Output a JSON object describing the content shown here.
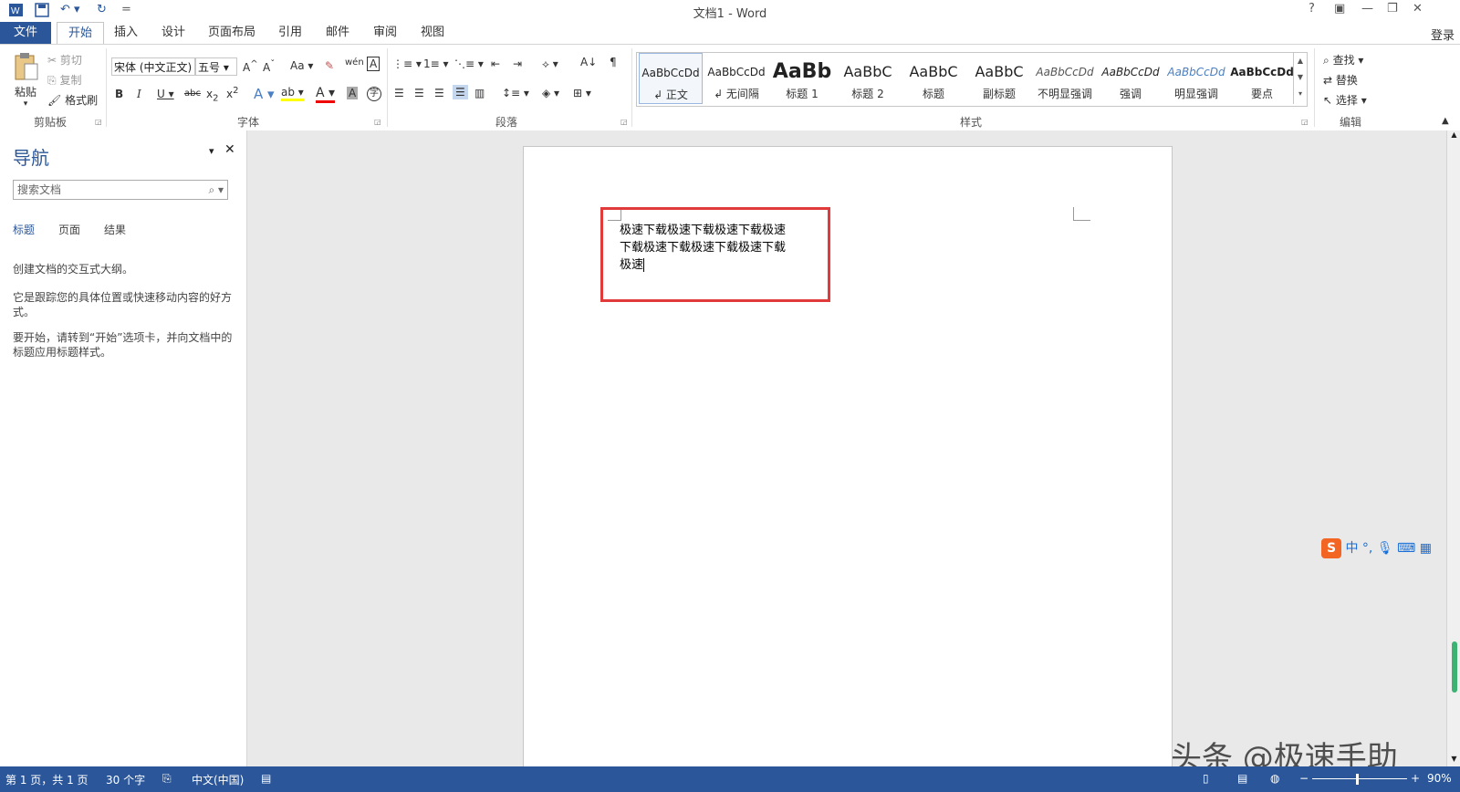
{
  "app": {
    "title": "文档1 - Word",
    "login": "登录"
  },
  "quick_access": {
    "undo_icon": "undo-icon",
    "redo_icon": "redo-icon",
    "save_icon": "save-icon",
    "customize": "="
  },
  "window_buttons": {
    "help": "?",
    "restore_ribbon": "▣",
    "minimize": "—",
    "maximize": "❐",
    "close": "✕"
  },
  "tabs": [
    {
      "label": "文件"
    },
    {
      "label": "开始"
    },
    {
      "label": "插入"
    },
    {
      "label": "设计"
    },
    {
      "label": "页面布局"
    },
    {
      "label": "引用"
    },
    {
      "label": "邮件"
    },
    {
      "label": "审阅"
    },
    {
      "label": "视图"
    }
  ],
  "clipboard": {
    "paste": "粘贴",
    "cut": "剪切",
    "copy": "复制",
    "format_painter": "格式刷",
    "label": "剪贴板"
  },
  "font": {
    "name": "宋体 (中文正文)",
    "size": "五号",
    "label": "字体"
  },
  "paragraph": {
    "label": "段落"
  },
  "styles": {
    "label": "样式",
    "items": [
      {
        "sample": "AaBbCcDd",
        "name": "↲ 正文"
      },
      {
        "sample": "AaBbCcDd",
        "name": "↲ 无间隔"
      },
      {
        "sample": "AaBb",
        "name": "标题 1"
      },
      {
        "sample": "AaBbC",
        "name": "标题 2"
      },
      {
        "sample": "AaBbC",
        "name": "标题"
      },
      {
        "sample": "AaBbC",
        "name": "副标题"
      },
      {
        "sample": "AaBbCcDd",
        "name": "不明显强调"
      },
      {
        "sample": "AaBbCcDd",
        "name": "强调"
      },
      {
        "sample": "AaBbCcDd",
        "name": "明显强调"
      },
      {
        "sample": "AaBbCcDd",
        "name": "要点"
      }
    ]
  },
  "editing": {
    "find": "查找",
    "replace": "替换",
    "select": "选择",
    "label": "编辑"
  },
  "nav": {
    "title": "导航",
    "search_placeholder": "搜索文档",
    "tabs": [
      "标题",
      "页面",
      "结果"
    ],
    "hint1": "创建文档的交互式大纲。",
    "hint2": "它是跟踪您的具体位置或快速移动内容的好方式。",
    "hint3": "要开始，请转到“开始”选项卡，并向文档中的标题应用标题样式。"
  },
  "document": {
    "line1": "极速下载极速下载极速下载极速",
    "line2": "下载极速下载极速下载极速下载",
    "line3": "极速"
  },
  "status": {
    "page": "第 1 页，共 1 页",
    "words": "30 个字",
    "language": "中文(中国)",
    "zoom": "90%"
  },
  "ime": {
    "mode": "中"
  },
  "watermark": "头条 @极速手助",
  "colors": {
    "accent": "#2b579a",
    "highlight_box": "#e03a3a"
  }
}
